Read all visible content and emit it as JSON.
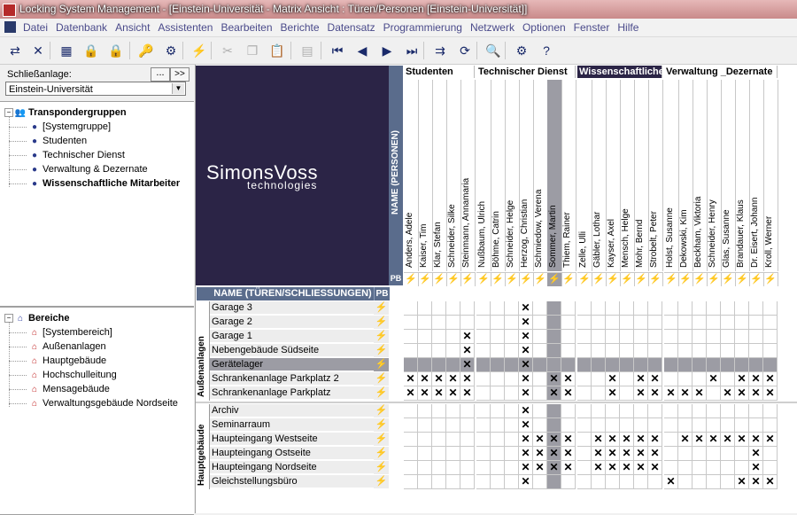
{
  "window": {
    "title": "Locking System Management - [Einstein-Universität - Matrix Ansicht : Türen/Personen [Einstein-Universität]]"
  },
  "menu": [
    "Datei",
    "Datenbank",
    "Ansicht",
    "Assistenten",
    "Bearbeiten",
    "Berichte",
    "Datensatz",
    "Programmierung",
    "Netzwerk",
    "Optionen",
    "Fenster",
    "Hilfe"
  ],
  "toolbar": {
    "buttons": [
      {
        "name": "shuffle-icon",
        "glyph": "⇄",
        "disabled": false
      },
      {
        "name": "close-x-icon",
        "glyph": "✕",
        "disabled": false
      },
      {
        "name": "new-door-icon",
        "glyph": "▦",
        "disabled": false
      },
      {
        "name": "new-lock-icon",
        "glyph": "🔒",
        "disabled": false
      },
      {
        "name": "new-lock-plus-icon",
        "glyph": "🔒",
        "disabled": false
      },
      {
        "name": "lock-key-icon",
        "glyph": "🔑",
        "disabled": false
      },
      {
        "name": "lock-settings-icon",
        "glyph": "⚙",
        "disabled": false
      },
      {
        "name": "lightning-icon",
        "glyph": "⚡",
        "disabled": true
      },
      {
        "name": "cut-icon",
        "glyph": "✂",
        "disabled": true
      },
      {
        "name": "copy-icon",
        "glyph": "❐",
        "disabled": true
      },
      {
        "name": "paste-icon",
        "glyph": "📋",
        "disabled": true
      },
      {
        "name": "print-icon",
        "glyph": "▤",
        "disabled": true
      },
      {
        "name": "first-record-icon",
        "glyph": "⏮",
        "disabled": false
      },
      {
        "name": "previous-record-icon",
        "glyph": "◀",
        "disabled": false
      },
      {
        "name": "next-record-icon",
        "glyph": "▶",
        "disabled": false
      },
      {
        "name": "last-record-icon",
        "glyph": "⏭",
        "disabled": false
      },
      {
        "name": "transfer-icon",
        "glyph": "⇉",
        "disabled": false
      },
      {
        "name": "refresh-icon",
        "glyph": "⟳",
        "disabled": false
      },
      {
        "name": "search-icon",
        "glyph": "🔍",
        "disabled": false
      },
      {
        "name": "properties-icon",
        "glyph": "⚙",
        "disabled": false
      },
      {
        "name": "help-icon",
        "glyph": "?",
        "disabled": false
      }
    ]
  },
  "sidebar": {
    "schliessanlage_label": "Schließanlage:",
    "browse_button": "...",
    "expand_button": ">>",
    "selected_anlage": "Einstein-Universität",
    "transponder_tree": {
      "root": "Transpondergruppen",
      "items": [
        "[Systemgruppe]",
        "Studenten",
        "Technischer Dienst",
        "Verwaltung & Dezernate",
        "Wissenschaftliche Mitarbeiter"
      ],
      "bold_item": "Wissenschaftliche Mitarbeiter"
    },
    "bereiche_tree": {
      "root": "Bereiche",
      "items": [
        "[Systembereich]",
        "Außenanlagen",
        "Hauptgebäude",
        "Hochschulleitung",
        "Mensagebäude",
        "Verwaltungsgebäude Nordseite"
      ]
    }
  },
  "matrix": {
    "logo_name": "SimonsVoss",
    "logo_sub": "technologies",
    "persons_header": "NAME (PERSONEN)",
    "doors_header": "NAME (TÜREN/SCHLIESSUNGEN)",
    "pb_label": "PB",
    "groups": [
      {
        "name": "Studenten",
        "persons": [
          "Anders, Adele",
          "Kaiser, Tim",
          "Klar, Stefan",
          "Schneider, Silke",
          "Steinmann, Annamaria"
        ]
      },
      {
        "name": "Technischer Dienst",
        "persons": [
          "Nußbaum, Ulrich",
          "Böhme, Catrin",
          "Schneider, Helge",
          "Herzog, Christian",
          "Schmiedow, Verena",
          "Sommer, Martin",
          "Thiem, Rainer"
        ]
      },
      {
        "name": "Wissenschaftliche",
        "persons": [
          "Zelle, Ulli",
          "Gäbler, Lothar",
          "Kayser, Axel",
          "Mensch, Helge",
          "Mohr, Bernd",
          "Strobelt, Peter"
        ]
      },
      {
        "name": "Verwaltung _Dezernate",
        "persons": [
          "Holst, Susanne",
          "Dekowski, Kim",
          "Beckham, Viktoria",
          "Schneider, Henry",
          "Glas, Susanne",
          "Brandauer, Klaus",
          "Dr. Eisert, Johann",
          "Kroll, Werner"
        ]
      }
    ],
    "sections": [
      {
        "name": "Außenanlagen",
        "doors": [
          {
            "name": "Garage 3",
            "x": [
              8
            ]
          },
          {
            "name": "Garage 2",
            "x": [
              8
            ]
          },
          {
            "name": "Garage 1",
            "x": [
              4,
              8
            ]
          },
          {
            "name": "Nebengebäude Südseite",
            "x": [
              4,
              8
            ]
          },
          {
            "name": "Gerätelager",
            "x": [
              4,
              8
            ]
          },
          {
            "name": "Schrankenanlage Parkplatz 2",
            "x": [
              0,
              1,
              2,
              3,
              4,
              8,
              10,
              11,
              14,
              16,
              17,
              21,
              23,
              24,
              25
            ]
          },
          {
            "name": "Schrankenanlage Parkplatz",
            "x": [
              0,
              1,
              2,
              3,
              4,
              8,
              10,
              11,
              14,
              16,
              17,
              18,
              19,
              20,
              22,
              23,
              24,
              25
            ]
          }
        ]
      },
      {
        "name": "Hauptgebäude",
        "doors": [
          {
            "name": "Archiv",
            "x": [
              8
            ]
          },
          {
            "name": "Seminarraum",
            "x": [
              8
            ]
          },
          {
            "name": "Haupteingang Westseite",
            "x": [
              8,
              9,
              10,
              11,
              13,
              14,
              15,
              16,
              17,
              19,
              20,
              21,
              22,
              23,
              24,
              25
            ]
          },
          {
            "name": "Haupteingang Ostseite",
            "x": [
              8,
              9,
              10,
              11,
              13,
              14,
              15,
              16,
              17,
              24
            ]
          },
          {
            "name": "Haupteingang Nordseite",
            "x": [
              8,
              9,
              10,
              11,
              13,
              14,
              15,
              16,
              17,
              24
            ]
          },
          {
            "name": "Gleichstellungsbüro",
            "x": [
              8,
              18,
              23,
              24,
              25
            ]
          }
        ]
      }
    ],
    "selected_person_index": 10,
    "selected_door": "Gerätelager"
  },
  "colors": {
    "header_blue": "#5a6c8c",
    "selection_gray": "#9c9ca4",
    "logo_bg": "#2b2446",
    "pb_lightning": "#f0b000"
  }
}
